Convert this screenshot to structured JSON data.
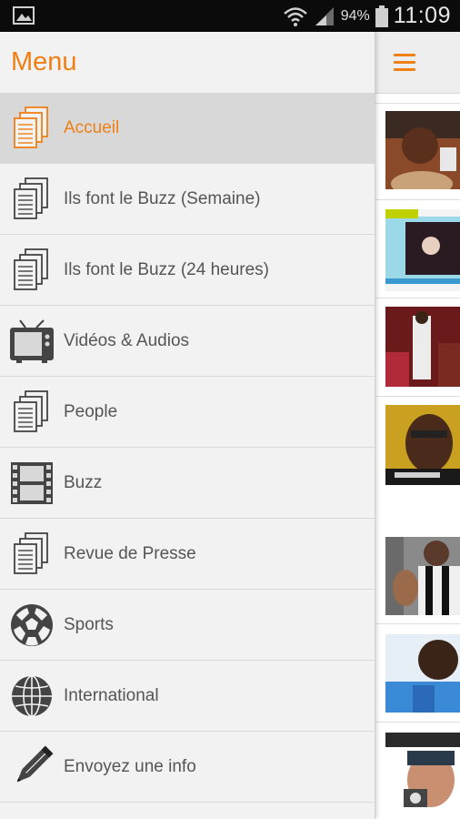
{
  "status_bar": {
    "battery": "94%",
    "time": "11:09"
  },
  "drawer": {
    "title": "Menu",
    "items": [
      {
        "label": "Accueil",
        "icon": "documents-icon",
        "active": true
      },
      {
        "label": "Ils font le Buzz (Semaine)",
        "icon": "documents-icon"
      },
      {
        "label": "Ils font le Buzz (24 heures)",
        "icon": "documents-icon"
      },
      {
        "label": "Vidéos & Audios",
        "icon": "tv-icon"
      },
      {
        "label": "People",
        "icon": "documents-icon"
      },
      {
        "label": "Buzz",
        "icon": "film-icon"
      },
      {
        "label": "Revue de Presse",
        "icon": "documents-icon"
      },
      {
        "label": "Sports",
        "icon": "soccer-ball-icon"
      },
      {
        "label": "International",
        "icon": "globe-icon"
      },
      {
        "label": "Envoyez une info",
        "icon": "pencil-icon"
      }
    ]
  },
  "colors": {
    "accent": "#f07f14",
    "drawer_bg": "#f2f2f2",
    "active_bg": "#d8d8d8",
    "text": "#555555"
  }
}
